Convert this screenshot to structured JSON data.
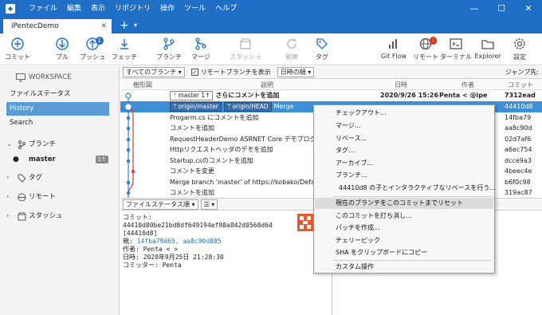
{
  "window": {
    "menu": [
      "ファイル",
      "編集",
      "表示",
      "リポジトリ",
      "操作",
      "ツール",
      "ヘルプ"
    ],
    "controls": [
      "—",
      "☐",
      "✕"
    ]
  },
  "tab": {
    "title": "iPentecDemo",
    "close": "✕",
    "add": "+",
    "dropdown": "▾"
  },
  "toolbar": {
    "commit": "コミット",
    "pull": "プル",
    "push": "プッシュ",
    "push_badge": "1",
    "fetch": "フェッチ",
    "branch": "ブランチ",
    "merge": "マージ",
    "stash": "スタッシュ",
    "discard": "破棄",
    "tag": "タグ",
    "gitflow": "Git Flow",
    "remote": "リモート",
    "remote_badge": "!",
    "terminal": "ターミナル",
    "explorer": "Explorer",
    "settings": "設定"
  },
  "sidebar": {
    "workspace": "WORKSPACE",
    "file_status": "ファイルステータス",
    "history": "History",
    "search": "Search",
    "branches": "ブランチ",
    "master": "master",
    "master_count": "1↑",
    "tags": "タグ",
    "remotes": "リモート",
    "stash": "スタッシュ"
  },
  "filter": {
    "branches": "すべてのブランチ ▾",
    "show_remote": "リモートブランチを表示",
    "sort": "日時の順 ▾",
    "jump": "ジャンプ先:"
  },
  "columns": {
    "graph": "樹形図",
    "description": "説明",
    "date": "日時",
    "author": "作者",
    "commit": "コミット"
  },
  "commits": [
    {
      "refs": [
        {
          "name": "master",
          "count": "1↑"
        }
      ],
      "desc": "さらにコメントを追加",
      "date": "2020/9/26 15:26",
      "author": "Penta <",
      "email": "@ipe",
      "hash": "7312ead"
    },
    {
      "refs": [
        {
          "name": "origin/master"
        },
        {
          "name": "origin/HEAD"
        }
      ],
      "desc": "Merge",
      "date": "",
      "author": "",
      "email": "",
      "hash": "44410d8"
    },
    {
      "refs": [],
      "desc": "Progarm.cs にコメントを追加",
      "date": "",
      "author": "",
      "email": "",
      "hash": "14fba79"
    },
    {
      "refs": [],
      "desc": "コメントを追加",
      "date": "",
      "author": "",
      "email": "",
      "hash": "aa8c90d"
    },
    {
      "refs": [],
      "desc": "RequestHeaderDemo ASRNET Core デモプログラムの",
      "date": "",
      "author": "",
      "email": "",
      "hash": "02d7af6"
    },
    {
      "refs": [],
      "desc": "Httpリクエストヘッダのデモを追加",
      "date": "",
      "author": "",
      "email": "",
      "hash": "a6ec754"
    },
    {
      "refs": [],
      "desc": "Startup.csのコメントを追加",
      "date": "",
      "author": "",
      "email": "",
      "hash": "dcce9a3"
    },
    {
      "refs": [],
      "desc": "コメントを変更",
      "date": "",
      "author": "",
      "email": "",
      "hash": "4beec4e"
    },
    {
      "refs": [],
      "desc": "Merge branch 'master' of https://kobako/Defaul",
      "date": "",
      "author": "",
      "email": "",
      "hash": "b6f0c98"
    },
    {
      "refs": [],
      "desc": "コメントを追加",
      "date": "",
      "author": "",
      "email": "",
      "hash": "319ac87"
    }
  ],
  "bottom": {
    "file_status": "ファイルステータス順 ▾",
    "view": "☰ ▾"
  },
  "details": {
    "commit_label": "コミット:",
    "commit_full": "44410d80be21bd8df649194ef98a842d0568d64",
    "commit_short": "[44410d8]",
    "parent_label": "親:",
    "parents": "14fba79d65, aa8c90d885",
    "author_label": "作者:",
    "author_value": "Penta <                    >",
    "date_label": "日時:",
    "date_value": "2020年9月25日 21:28:30",
    "committer_label": "コミッター:",
    "committer_value": "Penta"
  },
  "context_menu": [
    "チェックアウト...",
    "マージ...",
    "リベース...",
    "タグ...",
    "アーカイブ...",
    "ブランチ...",
    "44410d8 の子とインタラクティブなリベースを行う...",
    "現在のブランチをこのコミットまでリセット",
    "このコミットを打ち消し...",
    "パッチを作成...",
    "チェリーピック",
    "SHA をクリップボードにコピー",
    "カスタム操作"
  ],
  "colors": {
    "accent": "#1f6fc7",
    "selection": "#3f8fd6",
    "sidebar_selection": "#5b9bd5",
    "graph_blue": "#2a7fd4",
    "graph_red": "#e0314b",
    "badge_red": "#d9341c"
  }
}
